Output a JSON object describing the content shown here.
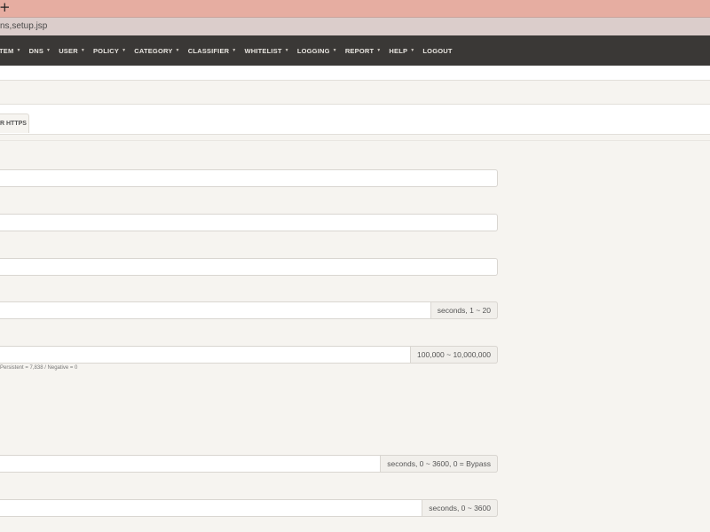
{
  "browser": {
    "new_tab_glyph": "+",
    "url": "ns,setup.jsp"
  },
  "navbar": {
    "items": [
      {
        "label": "TEM",
        "dropdown": true
      },
      {
        "label": "DNS",
        "dropdown": true
      },
      {
        "label": "USER",
        "dropdown": true
      },
      {
        "label": "POLICY",
        "dropdown": true
      },
      {
        "label": "CATEGORY",
        "dropdown": true
      },
      {
        "label": "CLASSIFIER",
        "dropdown": true
      },
      {
        "label": "WHITELIST",
        "dropdown": true
      },
      {
        "label": "LOGGING",
        "dropdown": true
      },
      {
        "label": "REPORT",
        "dropdown": true
      },
      {
        "label": "HELP",
        "dropdown": true
      },
      {
        "label": "LOGOUT",
        "dropdown": false
      }
    ],
    "caret_glyph": "▼"
  },
  "tabs": {
    "active_label": "R HTTPS"
  },
  "form": {
    "fields": [
      {
        "value": "",
        "addon": ""
      },
      {
        "value": "",
        "addon": ""
      },
      {
        "value": "",
        "addon": ""
      },
      {
        "value": "",
        "addon": "seconds, 1 ~ 20"
      },
      {
        "value": "",
        "addon": "100,000 ~ 10,000,000"
      },
      {
        "value": "",
        "addon": "seconds, 0 ~ 3600, 0 = Bypass"
      },
      {
        "value": "",
        "addon": "seconds, 0 ~ 3600"
      }
    ],
    "cache_help_text": "Persistent = 7,838 / Negative = 0"
  },
  "colors": {
    "tabbar": "#e6ada1",
    "addressbar": "#dbcdcb",
    "navbar": "#3a3836",
    "page_background": "#f6f4f0"
  }
}
